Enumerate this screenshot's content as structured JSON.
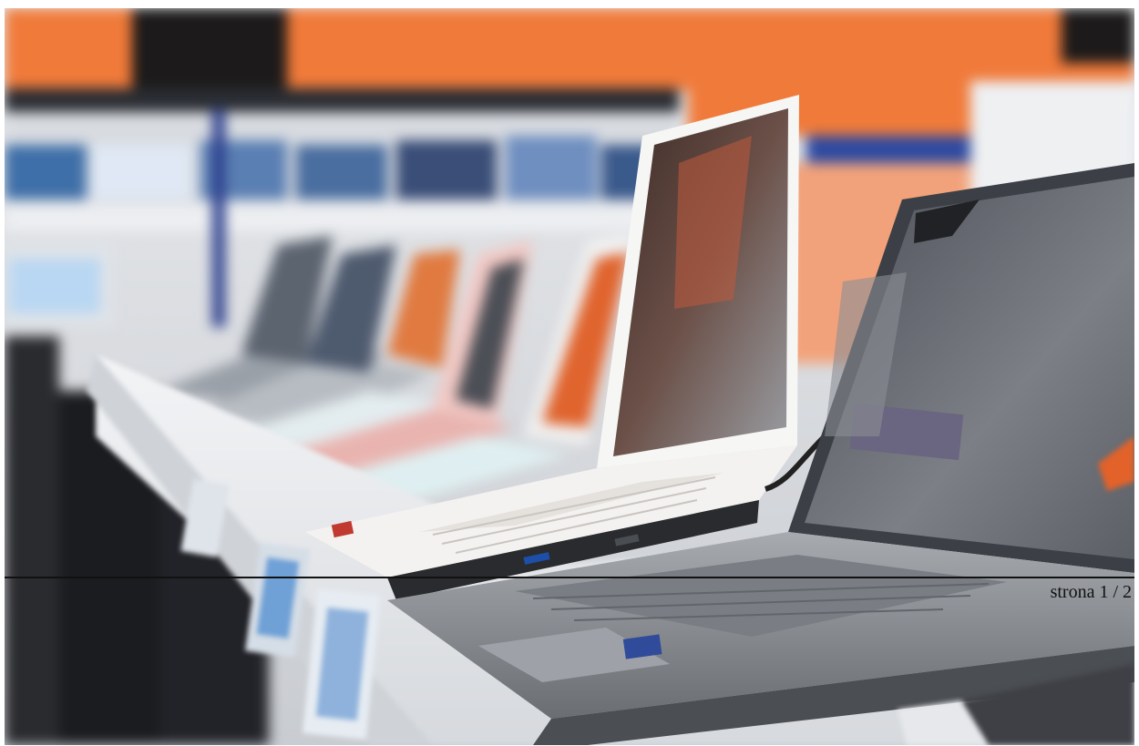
{
  "page_indicator": {
    "label": "strona 1 / 2"
  },
  "photo": {
    "subject": "laptops-on-store-display-shelf",
    "colors": {
      "signage_orange": "#f07a3a",
      "shelf_white": "#e9ecef",
      "laptop_white": "#f4f4f2",
      "laptop_gray": "#8a8e93",
      "screen_dark": "#3a3d42"
    }
  }
}
